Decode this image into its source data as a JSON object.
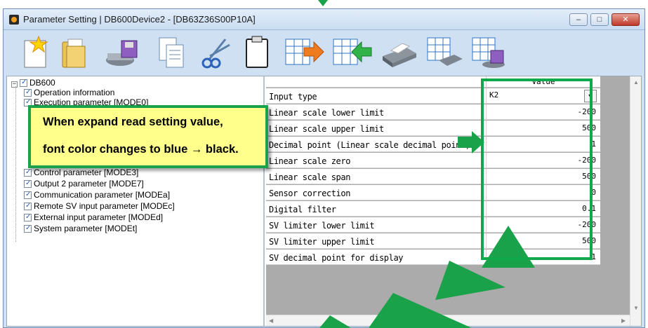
{
  "window": {
    "title": "Parameter Setting  | DB600Device2 - [DB63Z36S00P10A]",
    "buttons": {
      "minimize": "–",
      "maximize": "□",
      "close": "✕"
    }
  },
  "toolbar": {
    "icons": [
      "new-file-icon",
      "open-folder-icon",
      "save-disk-icon",
      "copy-icon",
      "cut-icon",
      "paste-icon",
      "read-from-device-icon",
      "write-to-device-icon",
      "print-icon",
      "print-preview-icon",
      "save-table-icon"
    ]
  },
  "tree": {
    "root": {
      "expander": "−",
      "label": "DB600"
    },
    "items": [
      "Operation information",
      "Execution parameter [MODE0]",
      "Control parameter [MODE3]",
      "Output 2 parameter [MODE7]",
      "Communication parameter [MODEa]",
      "Remote SV input parameter [MODEc]",
      "External input parameter [MODEd]",
      "System parameter [MODEt]"
    ]
  },
  "grid": {
    "column_header": "Value",
    "rows": [
      {
        "name": "Input type",
        "value": "K2",
        "dropdown": true
      },
      {
        "name": "Linear scale lower limit",
        "value": "-200"
      },
      {
        "name": "Linear scale upper limit",
        "value": "500"
      },
      {
        "name": "Decimal point (Linear scale decimal point)",
        "value": "1"
      },
      {
        "name": "Linear scale zero",
        "value": "-200"
      },
      {
        "name": "Linear scale span",
        "value": "500"
      },
      {
        "name": "Sensor correction",
        "value": "0"
      },
      {
        "name": "Digital filter",
        "value": "0.1"
      },
      {
        "name": "SV limiter lower limit",
        "value": "-200"
      },
      {
        "name": "SV limiter upper limit",
        "value": "500"
      },
      {
        "name": "SV decimal point for display",
        "value": "1"
      }
    ]
  },
  "callout": {
    "line1": "When expand read setting value,",
    "line2": "font color changes to blue → black."
  },
  "colors": {
    "accent_green": "#19a24a",
    "callout_fill": "#ffff8c",
    "titlebar": "#c9dcf1"
  }
}
